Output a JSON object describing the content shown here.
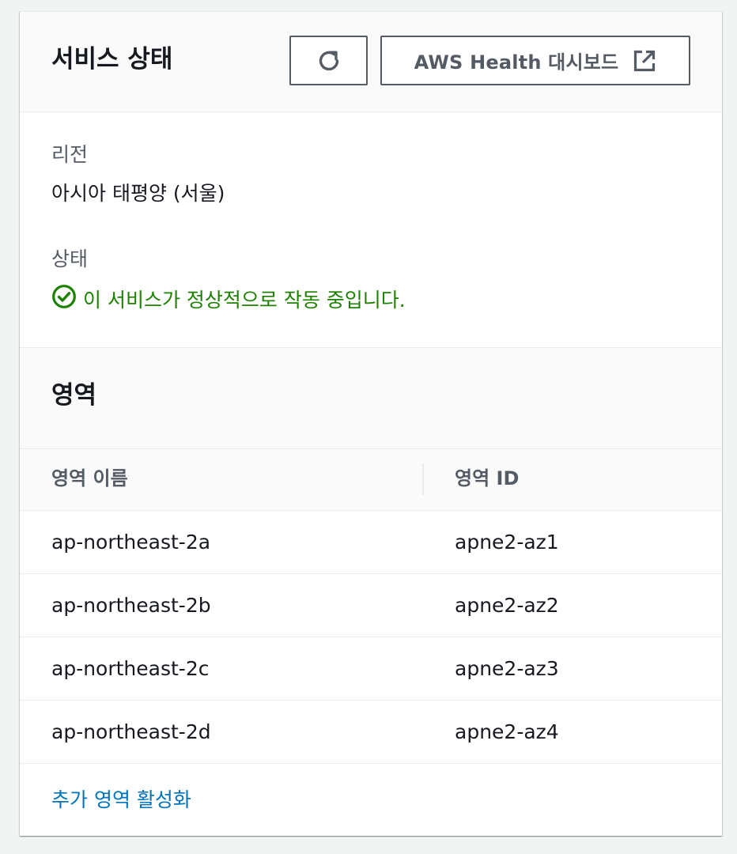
{
  "header": {
    "title": "서비스 상태",
    "refresh_icon": "refresh-icon",
    "health_button_label": "AWS Health 대시보드",
    "external_icon": "external-link-icon"
  },
  "region": {
    "label": "리전",
    "value": "아시아 태평양 (서울)"
  },
  "status": {
    "label": "상태",
    "icon": "status-positive-icon",
    "text": "이 서비스가 정상적으로 작동 중입니다.",
    "color": "#1d8102"
  },
  "zones": {
    "title": "영역",
    "columns": [
      "영역 이름",
      "영역 ID"
    ],
    "rows": [
      {
        "name": "ap-northeast-2a",
        "id": "apne2-az1"
      },
      {
        "name": "ap-northeast-2b",
        "id": "apne2-az2"
      },
      {
        "name": "ap-northeast-2c",
        "id": "apne2-az3"
      },
      {
        "name": "ap-northeast-2d",
        "id": "apne2-az4"
      }
    ],
    "enable_link": "추가 영역 활성화"
  },
  "colors": {
    "link": "#0073bb",
    "success": "#1d8102",
    "button_border": "#545b64"
  }
}
